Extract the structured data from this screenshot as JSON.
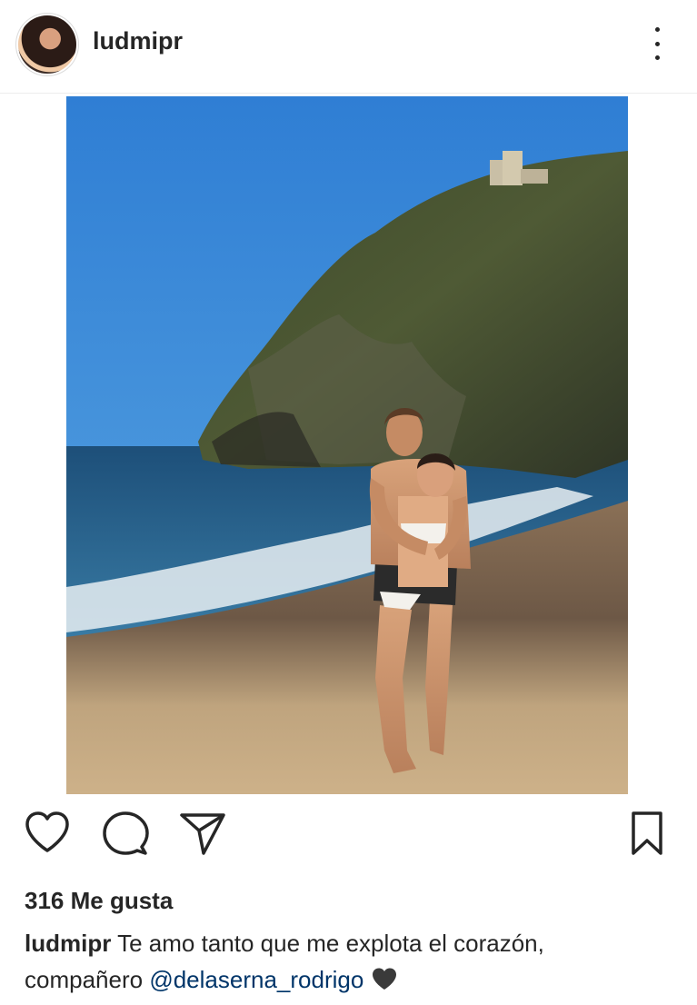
{
  "post": {
    "username": "ludmipr",
    "likes_text": "316 Me gusta",
    "caption": {
      "username": "ludmipr",
      "text_line1": "Te amo tanto que me explota el corazón,",
      "text_prefix": "compañero",
      "mention": "@delaserna_rodrigo",
      "emoji": "black-heart-icon"
    }
  },
  "icons": {
    "like": "heart-outline-icon",
    "comment": "comment-bubble-icon",
    "share": "paper-plane-icon",
    "save": "bookmark-icon",
    "more": "more-vertical-icon"
  },
  "colors": {
    "text": "#262626",
    "mention": "#003569",
    "divider": "#ececec"
  }
}
